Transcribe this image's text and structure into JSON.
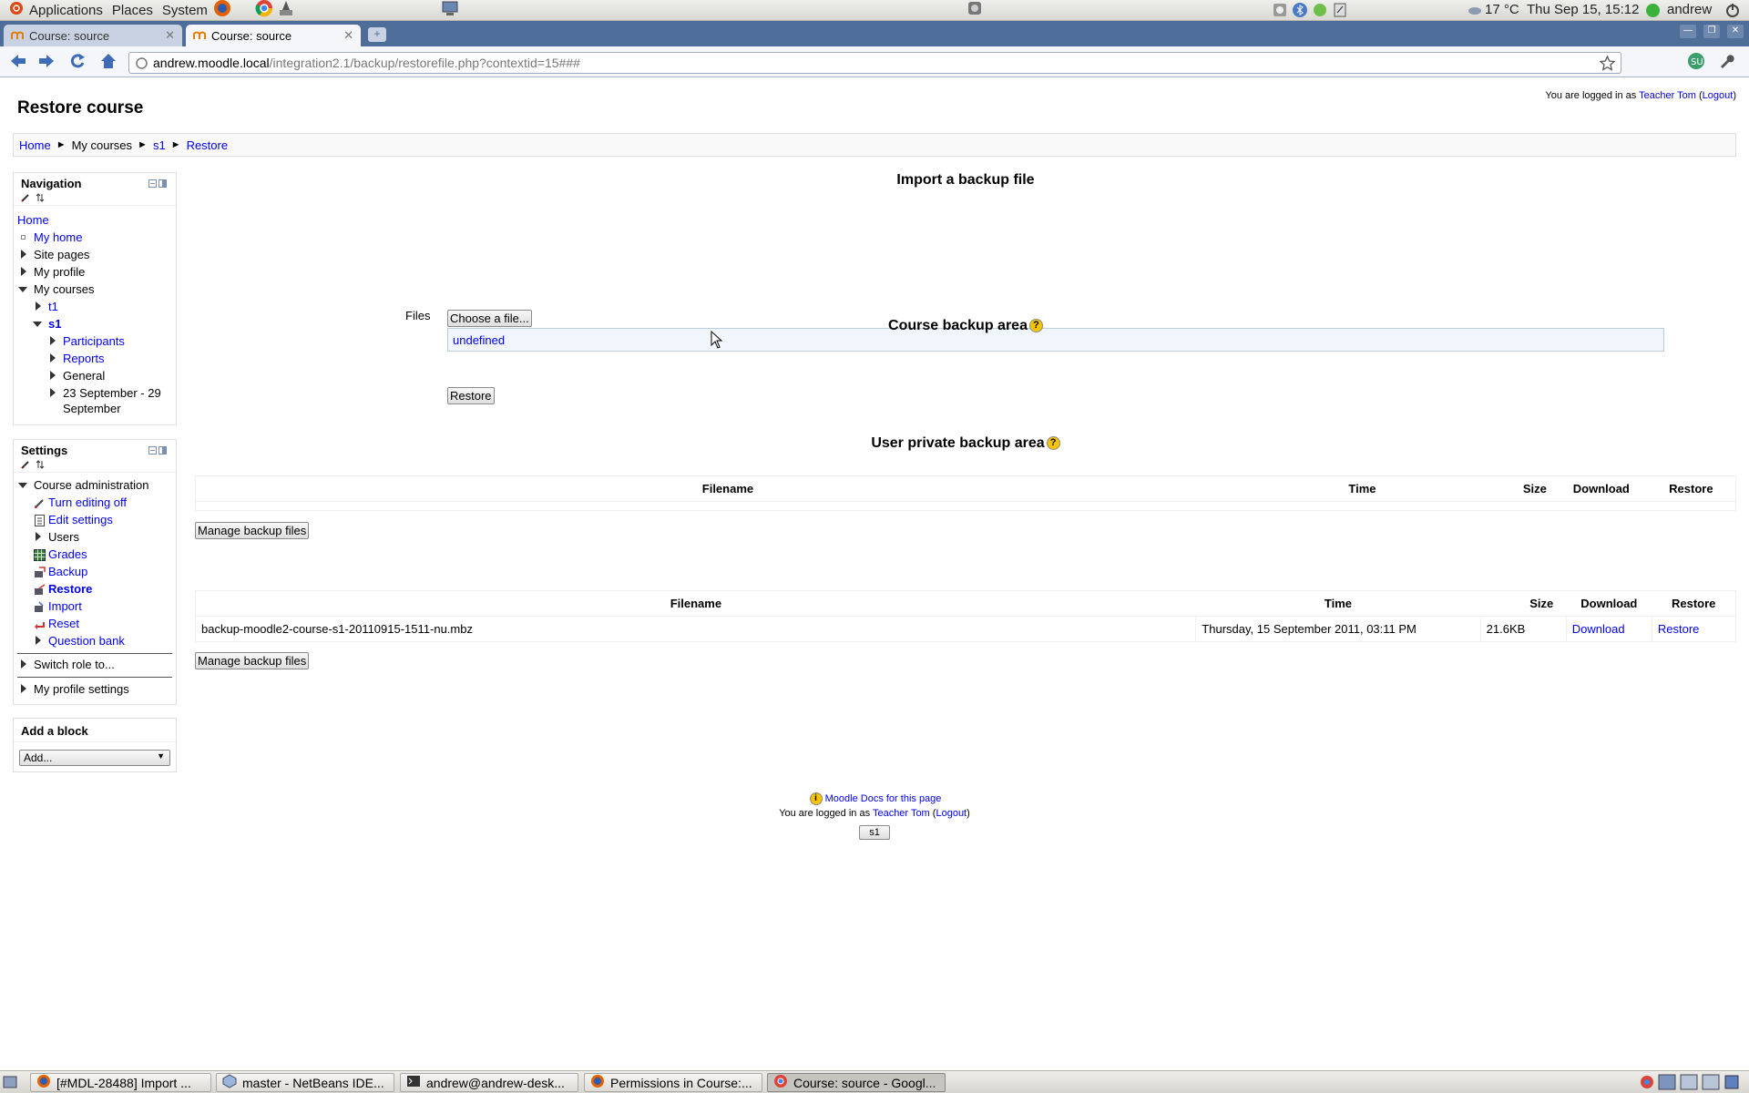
{
  "gnome": {
    "menu_applications": "Applications",
    "menu_places": "Places",
    "menu_system": "System",
    "weather": "17 °C",
    "clock": "Thu Sep 15, 15:12",
    "user": "andrew"
  },
  "browser": {
    "tabs": [
      {
        "title": "Course: source"
      },
      {
        "title": "Course: source"
      }
    ],
    "url_host": "andrew.moodle.local",
    "url_path": "/integration2.1/backup/restorefile.php?contextid=15###"
  },
  "page": {
    "title": "Restore course",
    "login_prefix": "You are logged in as",
    "login_user": "Teacher Tom",
    "logout": "Logout",
    "breadcrumb": [
      "Home",
      "My courses",
      "s1",
      "Restore"
    ]
  },
  "navigation": {
    "title": "Navigation",
    "home": "Home",
    "items": [
      "My home",
      "Site pages",
      "My profile",
      "My courses",
      "t1",
      "s1",
      "Participants",
      "Reports",
      "General",
      "23 September - 29",
      "September"
    ]
  },
  "settings": {
    "title": "Settings",
    "course_admin": "Course administration",
    "items": [
      "Turn editing off",
      "Edit settings",
      "Users",
      "Grades",
      "Backup",
      "Restore",
      "Import",
      "Reset",
      "Question bank"
    ],
    "switch_role": "Switch role to...",
    "profile_settings": "My profile settings"
  },
  "add_block": {
    "title": "Add a block",
    "select_value": "Add..."
  },
  "import": {
    "heading": "Import a backup file",
    "files_label": "Files",
    "choose_button": "Choose a file...",
    "file_value": "undefined",
    "restore_button": "Restore"
  },
  "course_backup": {
    "heading": "Course backup area",
    "columns": [
      "Filename",
      "Time",
      "Size",
      "Download",
      "Restore"
    ],
    "manage_button": "Manage backup files"
  },
  "user_backup": {
    "heading": "User private backup area",
    "columns": [
      "Filename",
      "Time",
      "Size",
      "Download",
      "Restore"
    ],
    "row": {
      "filename": "backup-moodle2-course-s1-20110915-1511-nu.mbz",
      "time": "Thursday, 15 September 2011, 03:11 PM",
      "size": "21.6KB",
      "download": "Download",
      "restore": "Restore"
    },
    "manage_button": "Manage backup files"
  },
  "footer": {
    "docs": "Moodle Docs for this page",
    "login_prefix": "You are logged in as",
    "login_user": "Teacher Tom",
    "logout": "Logout",
    "course_button": "s1"
  },
  "taskbar": [
    {
      "label": "[#MDL-28488] Import ..."
    },
    {
      "label": "master - NetBeans IDE..."
    },
    {
      "label": "andrew@andrew-desk..."
    },
    {
      "label": "Permissions in Course:..."
    },
    {
      "label": "Course: source - Googl..."
    }
  ]
}
